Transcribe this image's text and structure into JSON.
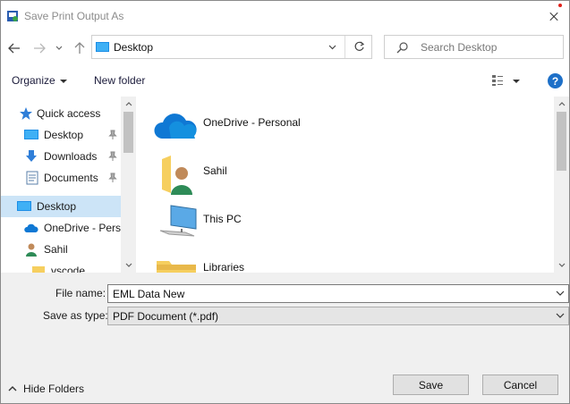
{
  "window": {
    "title": "Save Print Output As"
  },
  "address_bar": {
    "location": "Desktop",
    "search_placeholder": "Search Desktop"
  },
  "toolbar": {
    "organize_label": "Organize",
    "new_folder_label": "New folder",
    "help_label": "?"
  },
  "navigation_pane": {
    "items": [
      {
        "label": "Quick access",
        "icon": "star-icon"
      },
      {
        "label": "Desktop",
        "icon": "desktop-folder-icon",
        "pinned": true
      },
      {
        "label": "Downloads",
        "icon": "download-arrow-icon",
        "pinned": true
      },
      {
        "label": "Documents",
        "icon": "documents-icon",
        "pinned": true
      },
      {
        "label": "Desktop",
        "icon": "desktop-folder-icon",
        "selected": true
      },
      {
        "label": "OneDrive - Perso",
        "icon": "onedrive-cloud-icon"
      },
      {
        "label": "Sahil",
        "icon": "user-folder-icon"
      },
      {
        "label": "vscode",
        "icon": "folder-icon"
      }
    ]
  },
  "content_items": [
    {
      "label": "OneDrive - Personal",
      "icon": "onedrive-cloud-icon"
    },
    {
      "label": "Sahil",
      "icon": "user-folder-icon"
    },
    {
      "label": "This PC",
      "icon": "computer-icon"
    },
    {
      "label": "Libraries",
      "icon": "folder-icon"
    }
  ],
  "save_form": {
    "file_name_label": "File name:",
    "file_name_value": "EML Data New",
    "save_type_label": "Save as type:",
    "save_type_value": "PDF Document (*.pdf)"
  },
  "footer": {
    "hide_folders_label": "Hide Folders",
    "save_button": "Save",
    "cancel_button": "Cancel"
  },
  "colors": {
    "selected_bg": "#cce4f7",
    "folder_yellow": "#f6cf5f",
    "onedrive_blue": "#0f78d4",
    "help_blue": "#1e70c8"
  }
}
